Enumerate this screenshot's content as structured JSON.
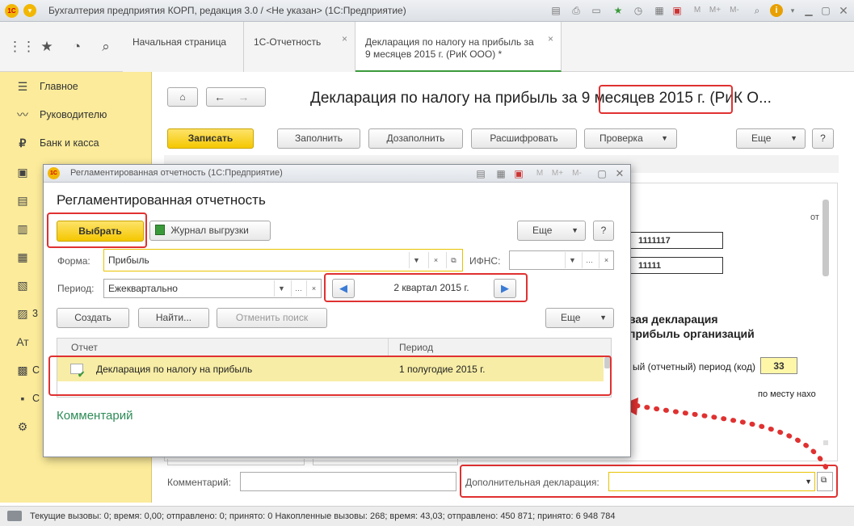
{
  "window": {
    "title": "Бухгалтерия предприятия КОРП, редакция 3.0 / <Не указан>  (1С:Предприятие)",
    "logo_text": "1С",
    "tools": [
      "M",
      "M+",
      "M-"
    ]
  },
  "tabs": [
    {
      "label": "Начальная страница"
    },
    {
      "label": "1С-Отчетность"
    },
    {
      "label": "Декларация по налогу на прибыль за 9 месяцев 2015 г.  (РиК ООО) *"
    }
  ],
  "sidebar": {
    "items": [
      {
        "label": "Главное",
        "icon": "☰"
      },
      {
        "label": "Руководителю",
        "icon": "〰"
      },
      {
        "label": "Банк и касса",
        "icon": "₽"
      }
    ],
    "icons_only": [
      "▣",
      "▤",
      "▥",
      "▦",
      "▧",
      "▨",
      "▩",
      "▪",
      "▫",
      "◧",
      "◨"
    ],
    "hidden_labels": [
      "3",
      "Ат",
      "C",
      "C"
    ]
  },
  "main": {
    "title": "Декларация по налогу на прибыль за 9 месяцев 2015 г. (РиК О...",
    "buttons": {
      "save": "Записать",
      "fill": "Заполнить",
      "refill": "Дозаполнить",
      "decode": "Расшифровать",
      "check": "Проверка",
      "more": "Еще",
      "help": "?"
    },
    "form": {
      "from_label": "от",
      "field1": "1111117",
      "field2": "11111",
      "decl_title1": "вая декларация",
      "decl_title2": "прибыль организаций",
      "period_code_label": "ый (отчетный) период (код)",
      "period_code": "33",
      "location_label": "по месту нахо"
    },
    "comment_label": "Комментарий:",
    "additional_label": "Дополнительная декларация:"
  },
  "dialog": {
    "titlebar": "Регламентированная отчетность  (1С:Предприятие)",
    "heading": "Регламентированная отчетность",
    "buttons": {
      "select": "Выбрать",
      "upload_log": "Журнал выгрузки",
      "more": "Еще",
      "help": "?",
      "create": "Создать",
      "find": "Найти...",
      "cancel_search": "Отменить поиск",
      "more2": "Еще"
    },
    "form_label": "Форма:",
    "form_value": "Прибыль",
    "ifns_label": "ИФНС:",
    "period_label": "Период:",
    "period_value": "Ежеквартально",
    "period_range": "2 квартал 2015 г.",
    "table": {
      "headers": [
        "Отчет",
        "Период"
      ],
      "rows": [
        {
          "report": "Декларация по налогу на прибыль",
          "period": "1 полугодие 2015 г."
        }
      ]
    },
    "comment_link": "Комментарий"
  },
  "status": {
    "text": "Текущие вызовы: 0; время: 0,00; отправлено: 0; принято: 0   Накопленные вызовы: 268; время: 43,03; отправлено: 450 871; принято: 6 948 784"
  },
  "colors": {
    "sidebar": "#fbeb9a",
    "accent_yellow": "#f5c700",
    "highlight_red": "#e03131",
    "link_green": "#2e8b57"
  }
}
